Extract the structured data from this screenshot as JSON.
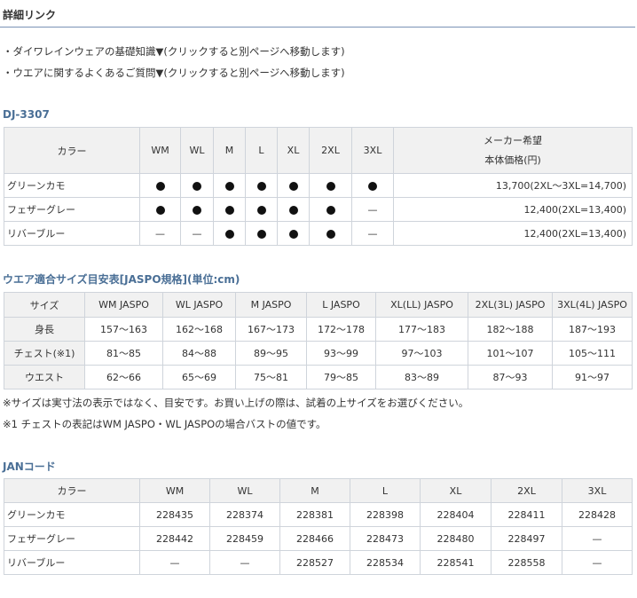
{
  "header": {
    "title": "詳細リンク"
  },
  "links": [
    "・ダイワレインウェアの基礎知識▼(クリックすると別ページへ移動します)",
    "・ウエアに関するよくあるご質問▼(クリックすると別ページへ移動します)"
  ],
  "model": {
    "title": "DJ-3307",
    "header_color": "カラー",
    "sizes": [
      "WM",
      "WL",
      "M",
      "L",
      "XL",
      "2XL",
      "3XL"
    ],
    "price_header_1": "メーカー希望",
    "price_header_2": "本体価格(円)",
    "available_mark": "●",
    "unavailable_mark": "—",
    "rows": [
      {
        "color": "グリーンカモ",
        "avail": [
          true,
          true,
          true,
          true,
          true,
          true,
          true
        ],
        "price": "13,700(2XL〜3XL=14,700)"
      },
      {
        "color": "フェザーグレー",
        "avail": [
          true,
          true,
          true,
          true,
          true,
          true,
          false
        ],
        "price": "12,400(2XL=13,400)"
      },
      {
        "color": "リバーブルー",
        "avail": [
          false,
          false,
          true,
          true,
          true,
          true,
          false
        ],
        "price": "12,400(2XL=13,400)"
      }
    ]
  },
  "size_chart": {
    "title": "ウエア適合サイズ目安表[JASPO規格](単位:cm)",
    "headers": [
      "サイズ",
      "WM JASPO",
      "WL JASPO",
      "M JASPO",
      "L JASPO",
      "XL(LL) JASPO",
      "2XL(3L) JASPO",
      "3XL(4L) JASPO"
    ],
    "rows": [
      [
        "身長",
        "157〜163",
        "162〜168",
        "167〜173",
        "172〜178",
        "177〜183",
        "182〜188",
        "187〜193"
      ],
      [
        "チェスト(※1)",
        "81〜85",
        "84〜88",
        "89〜95",
        "93〜99",
        "97〜103",
        "101〜107",
        "105〜111"
      ],
      [
        "ウエスト",
        "62〜66",
        "65〜69",
        "75〜81",
        "79〜85",
        "83〜89",
        "87〜93",
        "91〜97"
      ]
    ],
    "notes": [
      "※サイズは実寸法の表示ではなく、目安です。お買い上げの際は、試着の上サイズをお選びください。",
      "※1 チェストの表記はWM JASPO・WL JASPOの場合バストの値です。"
    ]
  },
  "jan": {
    "title": "JANコード",
    "headers": [
      "カラー",
      "WM",
      "WL",
      "M",
      "L",
      "XL",
      "2XL",
      "3XL"
    ],
    "rows": [
      [
        "グリーンカモ",
        "228435",
        "228374",
        "228381",
        "228398",
        "228404",
        "228411",
        "228428"
      ],
      [
        "フェザーグレー",
        "228442",
        "228459",
        "228466",
        "228473",
        "228480",
        "228497",
        "—"
      ],
      [
        "リバーブルー",
        "—",
        "—",
        "228527",
        "228534",
        "228541",
        "228558",
        "—"
      ]
    ]
  }
}
